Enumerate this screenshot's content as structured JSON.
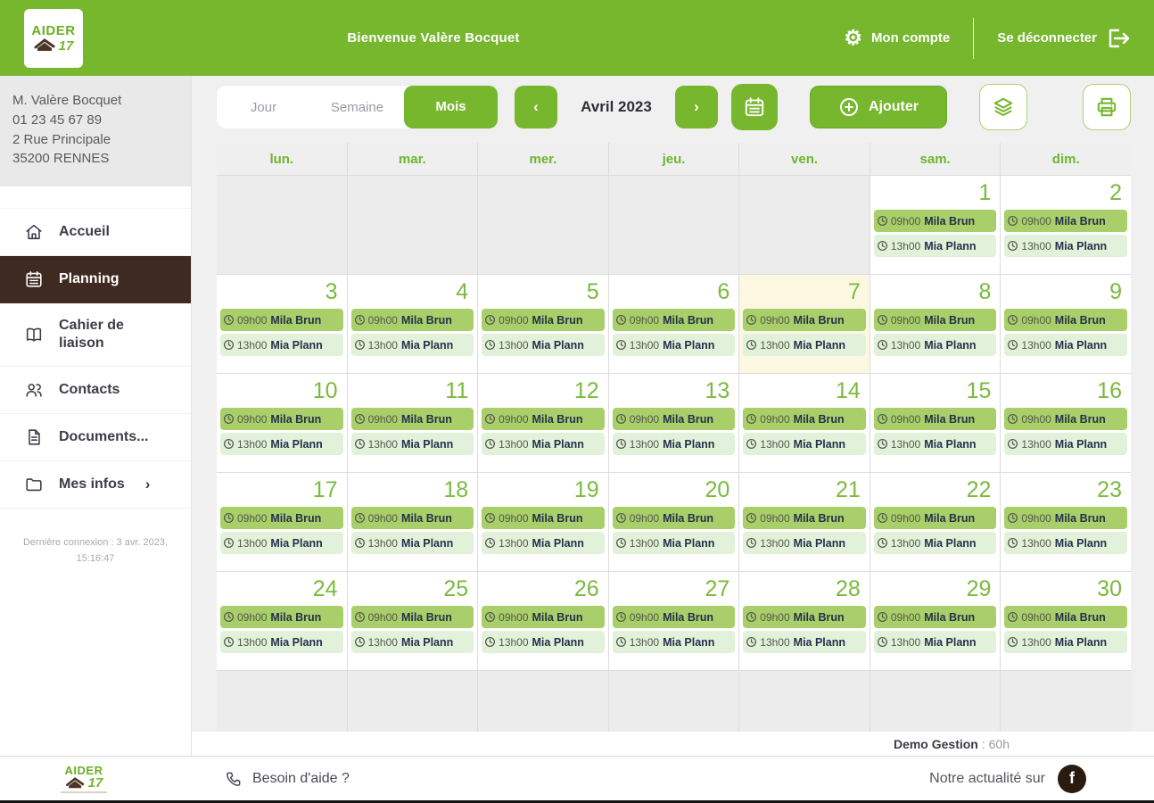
{
  "header": {
    "logo_line1": "AIDER",
    "logo_line2": "17",
    "welcome": "Bienvenue Valère Bocquet",
    "account": "Mon compte",
    "logout": "Se déconnecter"
  },
  "sidebar": {
    "user_name": "M. Valère Bocquet",
    "user_phone": "01 23 45 67 89",
    "user_address1": "2 Rue Principale",
    "user_address2": "35200 RENNES",
    "items": [
      {
        "label": "Accueil"
      },
      {
        "label": "Planning"
      },
      {
        "label": "Cahier de liaison"
      },
      {
        "label": "Contacts"
      },
      {
        "label": "Documents..."
      },
      {
        "label": "Mes infos"
      }
    ],
    "last_connection": "Dernière connexion : 3 avr. 2023, 15:16:47"
  },
  "toolbar": {
    "view_day": "Jour",
    "view_week": "Semaine",
    "view_month": "Mois",
    "month_label": "Avril 2023",
    "add": "Ajouter"
  },
  "calendar": {
    "day_headers": [
      "lun.",
      "mar.",
      "mer.",
      "jeu.",
      "ven.",
      "sam.",
      "dim."
    ],
    "today": 7,
    "weeks": [
      [
        null,
        null,
        null,
        null,
        null,
        1,
        2
      ],
      [
        3,
        4,
        5,
        6,
        7,
        8,
        9
      ],
      [
        10,
        11,
        12,
        13,
        14,
        15,
        16
      ],
      [
        17,
        18,
        19,
        20,
        21,
        22,
        23
      ],
      [
        24,
        25,
        26,
        27,
        28,
        29,
        30
      ],
      [
        null,
        null,
        null,
        null,
        null,
        null,
        null
      ]
    ],
    "events": [
      {
        "time": "09h00",
        "name": "Mila Brun",
        "style": "solid"
      },
      {
        "time": "13h00",
        "name": "Mia Plann",
        "style": "light"
      }
    ]
  },
  "status": {
    "label": "Demo Gestion",
    "value": ": 60h"
  },
  "footer": {
    "help": "Besoin d'aide ?",
    "news": "Notre actualité sur",
    "fb": "f",
    "logo_line1": "AIDER",
    "logo_line2": "17"
  },
  "colors": {
    "green": "#76b72e",
    "brown_active": "#3e2a20",
    "chip_solid": "#a9cf6a",
    "chip_light": "#e2f2da",
    "today_bg": "#fcf7e1"
  }
}
